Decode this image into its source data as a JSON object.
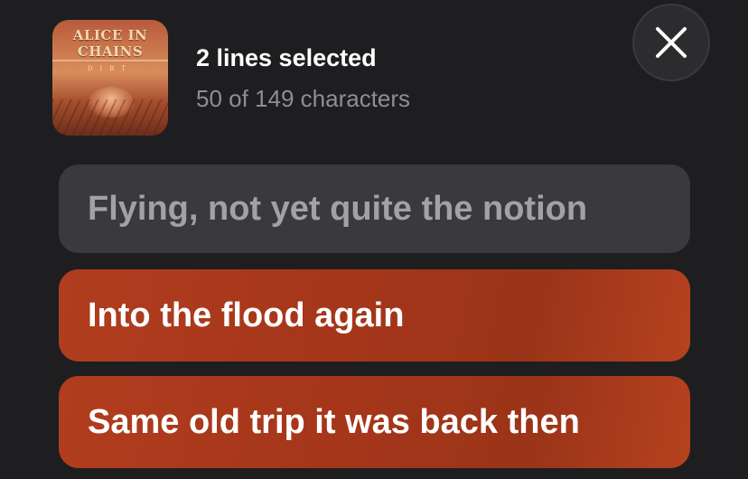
{
  "album": {
    "band_text": "ALICE IN CHAINS",
    "album_text": "DIRT",
    "art_colors": [
      "#b85a3c",
      "#d88d5c",
      "#6e2d1a"
    ]
  },
  "selection": {
    "summary": "2 lines selected",
    "character_count": "50 of 149 characters"
  },
  "close_button": {
    "icon": "close-icon"
  },
  "lyrics": {
    "lines": [
      {
        "text": "Flying, not yet quite the notion",
        "selected": false
      },
      {
        "text": "Into the flood again",
        "selected": true
      },
      {
        "text": "Same old trip it was back then",
        "selected": true
      }
    ]
  },
  "colors": {
    "background": "#1e1e20",
    "selected_line": "#a5361a",
    "unselected_line": "#3a3a3c",
    "secondary_text": "#8e8e93"
  }
}
